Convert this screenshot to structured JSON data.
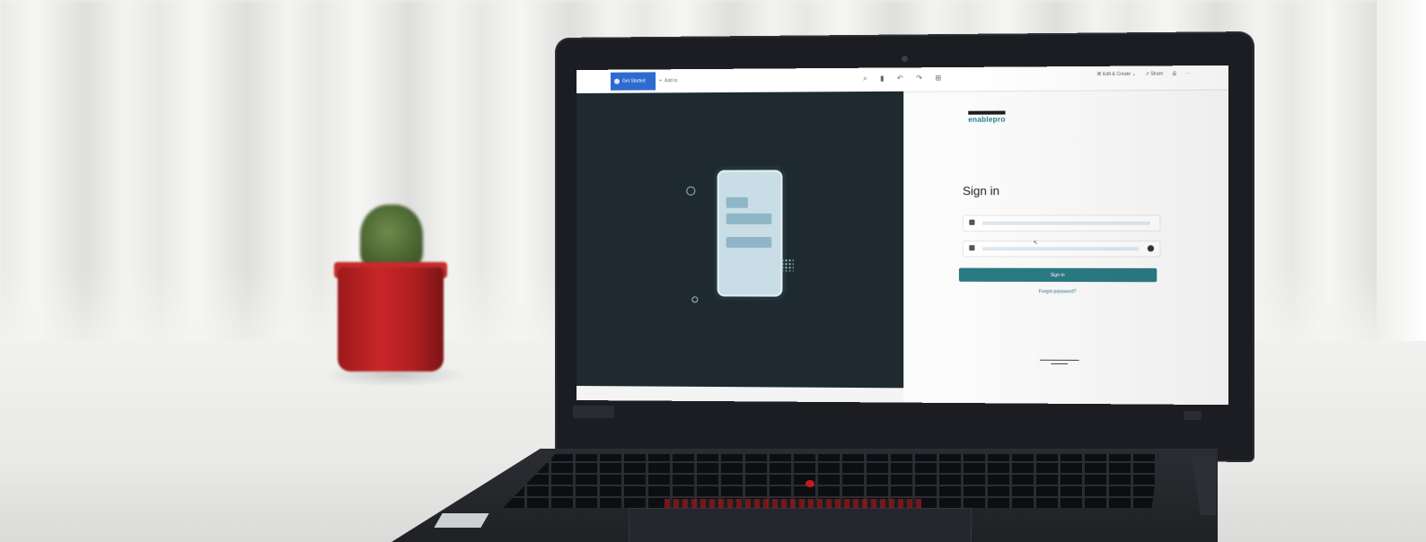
{
  "screen": {
    "topbar": {
      "active_tab": "Get Started",
      "inactive_tab": "Add to",
      "tool_icons": [
        "search-icon",
        "ruler-icon",
        "undo-icon",
        "redo-icon",
        "grid-icon"
      ],
      "edit_label": "Edit & Create",
      "share_label": "Share"
    },
    "login": {
      "logo_text": "enablepro",
      "title": "Sign in",
      "signin_button": "Sign in",
      "forgot_link": "Forgot password?"
    }
  },
  "colors": {
    "accent": "#2b7a82",
    "tab_blue": "#2d6bd1",
    "panel_dark": "#1e2a2f",
    "pot_red": "#c82628"
  }
}
